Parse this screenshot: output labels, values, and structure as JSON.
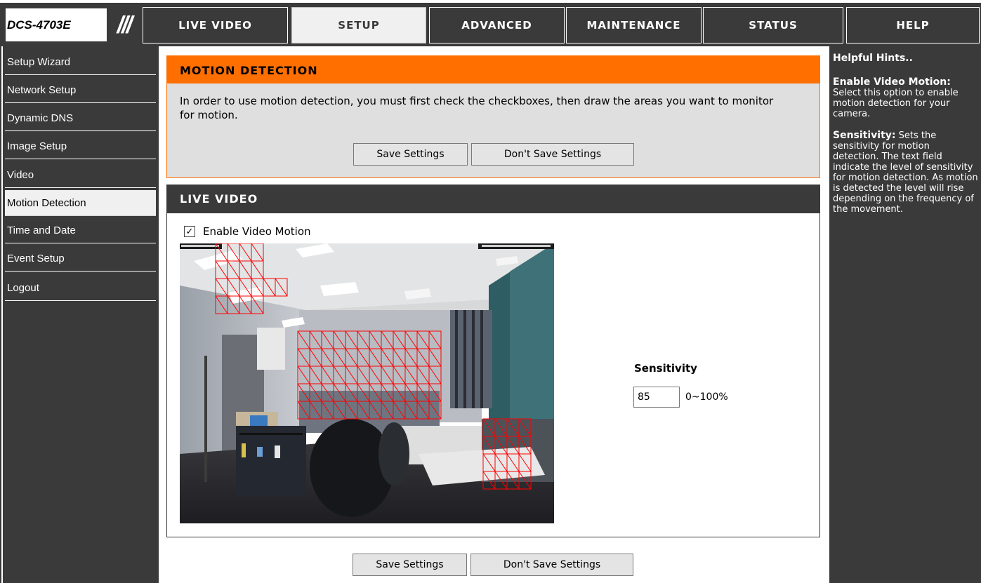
{
  "device": {
    "model": "DCS-4703E",
    "slashes": "///"
  },
  "top_tabs": [
    {
      "label": "LIVE VIDEO",
      "active": false
    },
    {
      "label": "SETUP",
      "active": true
    },
    {
      "label": "ADVANCED",
      "active": false
    },
    {
      "label": "MAINTENANCE",
      "active": false
    },
    {
      "label": "STATUS",
      "active": false
    },
    {
      "label": "HELP",
      "active": false
    }
  ],
  "sidebar": {
    "items": [
      {
        "label": "Setup Wizard",
        "active": false
      },
      {
        "label": "Network Setup",
        "active": false
      },
      {
        "label": "Dynamic DNS",
        "active": false
      },
      {
        "label": "Image Setup",
        "active": false
      },
      {
        "label": "Video",
        "active": false
      },
      {
        "label": "Motion Detection",
        "active": true
      },
      {
        "label": "Time and Date",
        "active": false
      },
      {
        "label": "Event Setup",
        "active": false
      },
      {
        "label": "Logout",
        "active": false
      }
    ]
  },
  "motion_detection": {
    "title": "MOTION DETECTION",
    "description": "In order to use motion detection, you must first check the checkboxes, then draw the areas you want to monitor for motion.",
    "save_label": "Save Settings",
    "dont_save_label": "Don't Save Settings"
  },
  "live_video": {
    "title": "LIVE VIDEO",
    "enable_label": "Enable Video Motion",
    "enable_checked": true,
    "checkmark": "✓",
    "sensitivity_label": "Sensitivity",
    "sensitivity_value": "85",
    "sensitivity_range": "0~100%"
  },
  "bottom_buttons": {
    "save_label": "Save Settings",
    "dont_save_label": "Don't Save Settings"
  },
  "help": {
    "title": "Helpful Hints..",
    "enable_head": "Enable Video Motion:",
    "enable_text": "Select this option to enable motion detection for your camera.",
    "sensitivity_head": "Sensitivity:",
    "sensitivity_text": "Sets the sensitivity for motion detection. The text field indicate the level of sensitivity for motion detection. As motion is detected the level will rise depending on the frequency of the movement."
  },
  "colors": {
    "dark": "#3a3a3a",
    "orange": "#ff6f00",
    "panel_gray": "#dfdfdf",
    "grid_red": "#ff0000"
  },
  "icons": [
    "checkmark-icon",
    "camera-feed-image",
    "motion-grid-overlay"
  ]
}
